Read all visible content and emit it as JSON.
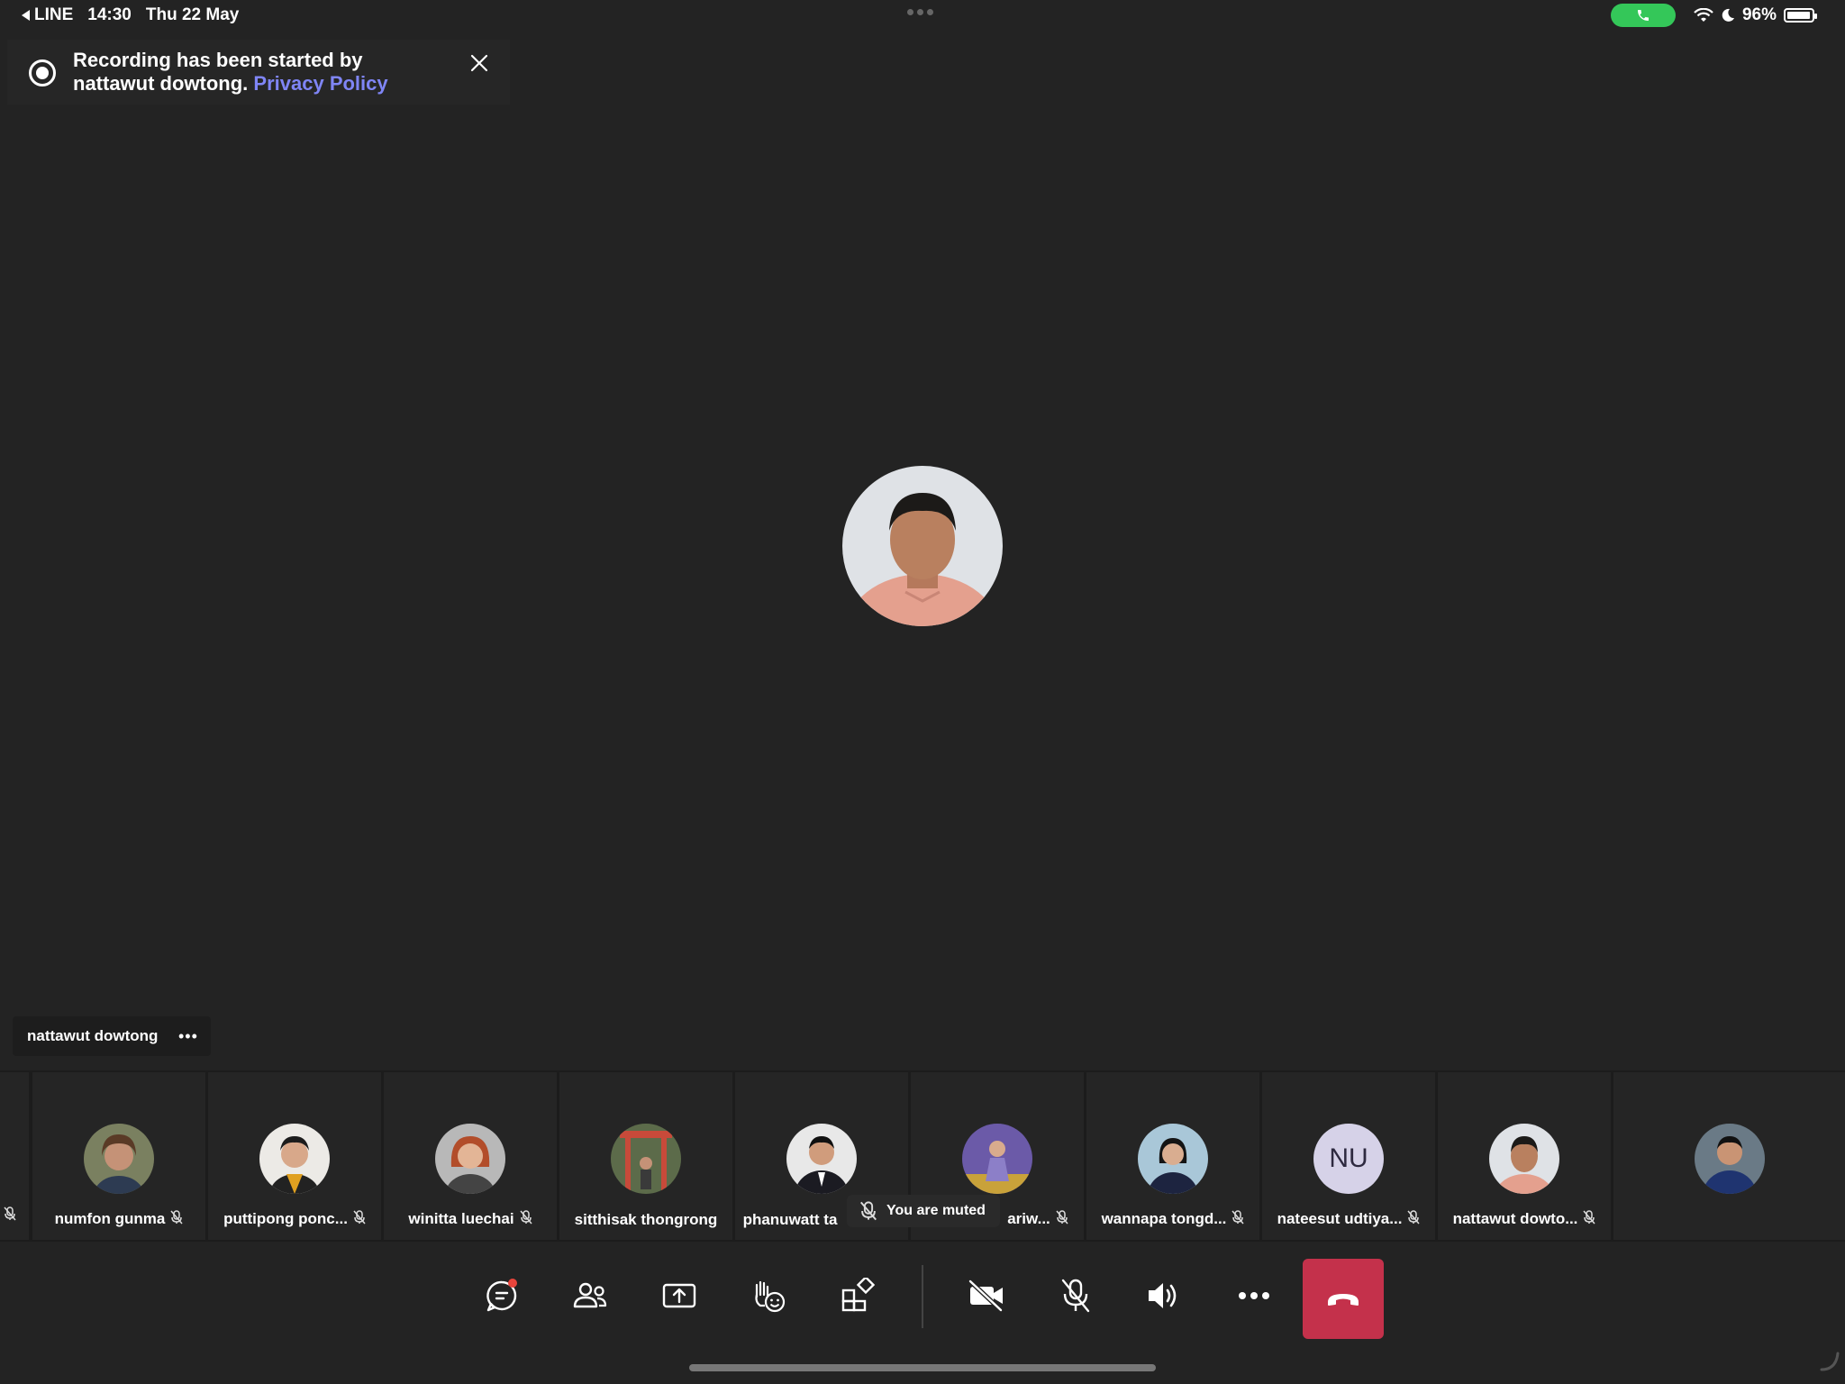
{
  "status_bar": {
    "back_app": "LINE",
    "time": "14:30",
    "date": "Thu 22 May",
    "battery": "96%",
    "battery_level": 0.96,
    "call_pill_color": "#34c759"
  },
  "recording_banner": {
    "line1": "Recording has been started by",
    "line2": "nattawut dowtong.",
    "link": "Privacy Policy",
    "link_color": "#7f85f5",
    "close_icon": "close-icon"
  },
  "main_stage": {
    "speaker_name": "nattawut dowtong",
    "more_label": "•••"
  },
  "participants": [
    {
      "name": "numfon gunma",
      "initials": ""
    },
    {
      "name": "puttipong ponc...",
      "initials": ""
    },
    {
      "name": "winitta luechai",
      "initials": ""
    },
    {
      "name": "sitthisak thongrong",
      "initials": ""
    },
    {
      "name": "phanuwatt ta",
      "initials": ""
    },
    {
      "name": "ariw...",
      "initials": ""
    },
    {
      "name": "wannapa tongd...",
      "initials": ""
    },
    {
      "name": "nateesut udtiya...",
      "initials": "NU"
    },
    {
      "name": "nattawut dowto...",
      "initials": ""
    },
    {
      "name": "",
      "initials": ""
    }
  ],
  "toast": {
    "text": "You are muted"
  },
  "toolbar": {
    "buttons": [
      "chat-icon",
      "people-icon",
      "share-screen-icon",
      "react-icon",
      "apps-icon",
      "camera-off-icon",
      "mic-off-icon",
      "speaker-icon",
      "more-icon",
      "hang-up-icon"
    ],
    "hangup_color": "#c4314b"
  }
}
